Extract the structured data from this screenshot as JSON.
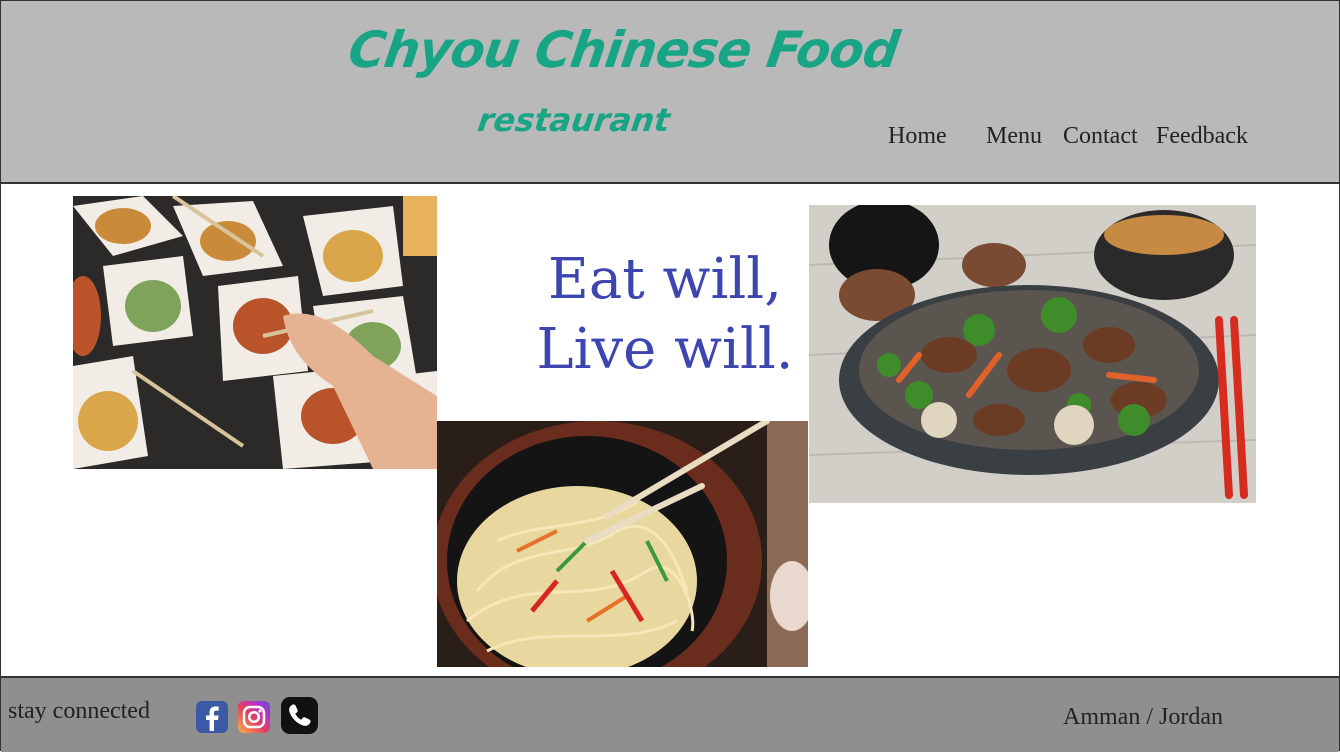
{
  "header": {
    "logo_title": "Chyou Chinese Food",
    "logo_subtitle": "restaurant",
    "nav": {
      "home": "Home",
      "menu": "Menu",
      "contact": "Contact",
      "feedback": "Feedback"
    }
  },
  "main": {
    "slogan_line1": "Eat will,",
    "slogan_line2": "Live will."
  },
  "footer": {
    "stay_connected": "stay connected",
    "social_icons": [
      "facebook-icon",
      "instagram-icon",
      "phone-icon"
    ],
    "location": "Amman / Jordan"
  },
  "colors": {
    "header_bg": "#bab9ba",
    "footer_bg": "#8f8f8f",
    "logo": "#17a585",
    "slogan": "#3d46b0"
  }
}
